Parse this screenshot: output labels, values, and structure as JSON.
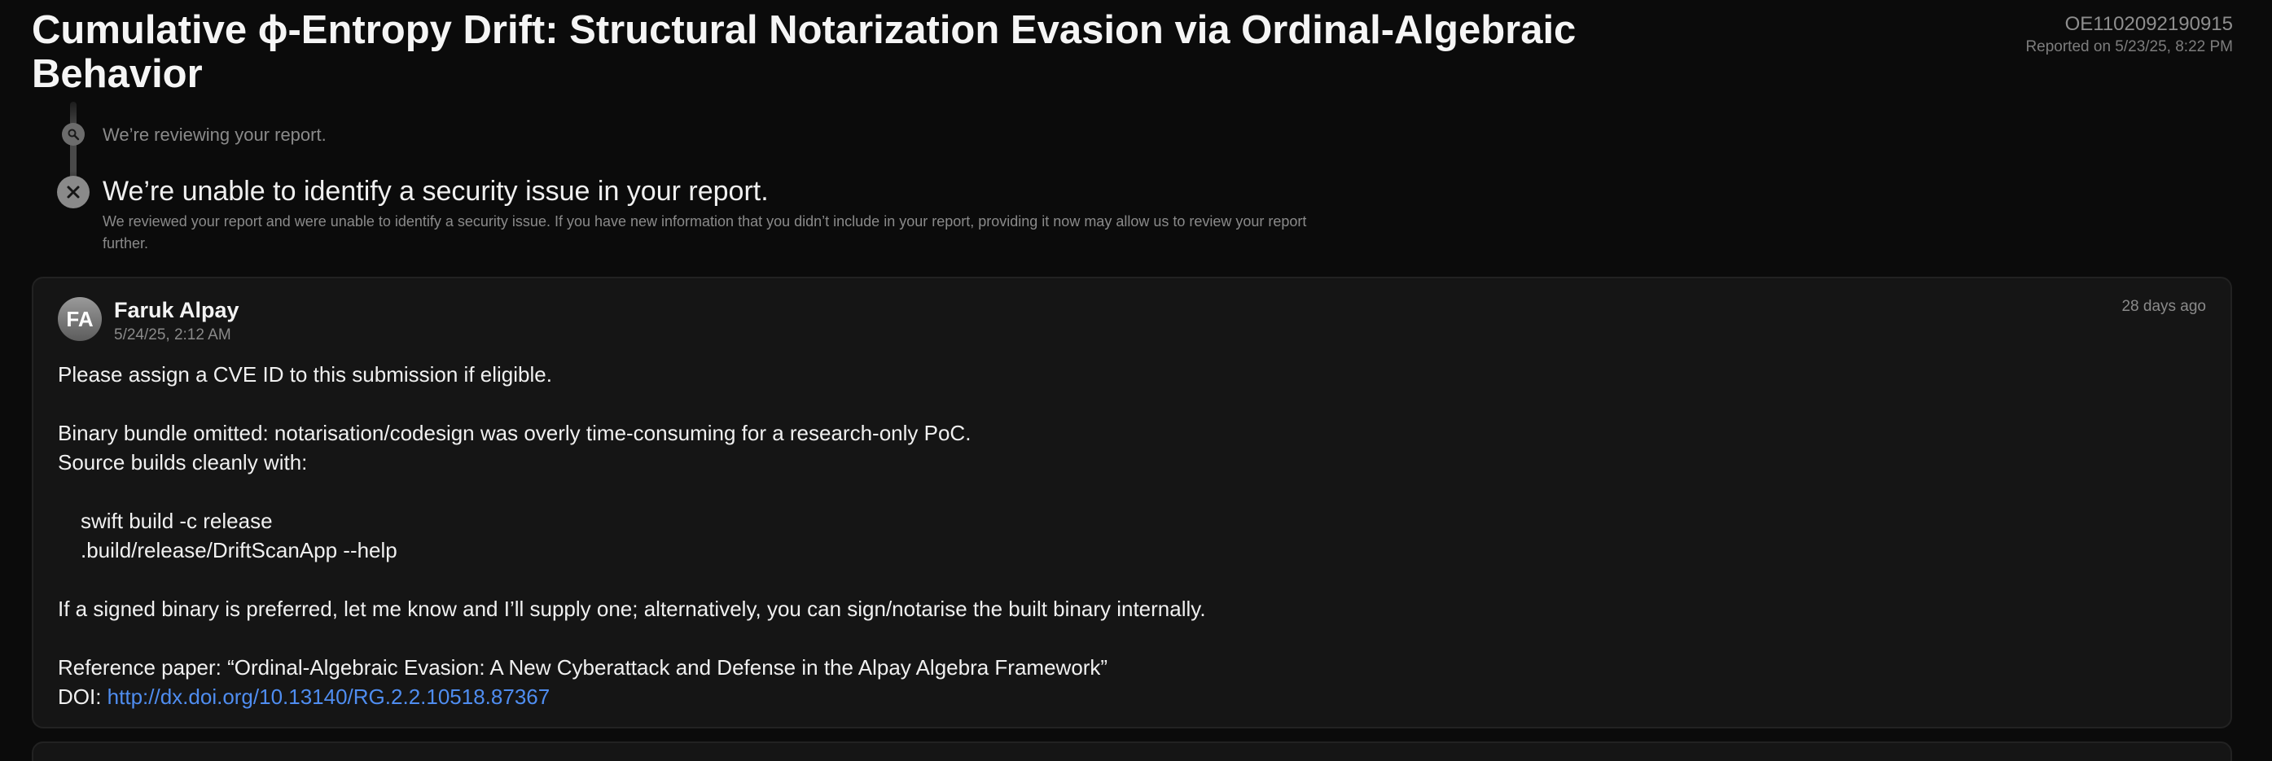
{
  "report": {
    "title": "Cumulative ϕ-Entropy Drift: Structural Notarization Evasion via Ordinal-Algebraic Behavior",
    "id": "OE1102092190915",
    "reported_on": "Reported on 5/23/25, 8:22 PM"
  },
  "timeline": {
    "step1_text": "We’re reviewing your report.",
    "step1_icon": "search-icon",
    "step2_title": "We’re unable to identify a security issue in your report.",
    "step2_desc": "We reviewed your report and were unable to identify a security issue. If you have new information that you didn’t include in your report, providing it now may allow us to review your report further.",
    "step2_icon": "close-icon"
  },
  "comment": {
    "avatar_initials": "FA",
    "author": "Faruk Alpay",
    "date": "5/24/25, 2:12 AM",
    "relative_time": "28 days ago",
    "line1": "Please assign a CVE ID to this submission if eligible.",
    "line2": "Binary bundle omitted: notarisation/codesign was overly time-consuming for a research-only PoC.",
    "line3": "Source builds cleanly with:",
    "cmd1": "swift build -c release",
    "cmd2": ".build/release/DriftScanApp --help",
    "line4": "If a signed binary is preferred, let me know and I’ll supply one; alternatively, you can sign/notarise the built binary internally.",
    "line5": "Reference paper: “Ordinal-Algebraic Evasion: A New Cyberattack and Defense in the Alpay Algebra Framework”",
    "doi_label": "DOI: ",
    "doi_link": "http://dx.doi.org/10.13140/RG.2.2.10518.87367"
  },
  "colors": {
    "background": "#0b0b0b",
    "card": "#151515",
    "link": "#4f8df0"
  }
}
